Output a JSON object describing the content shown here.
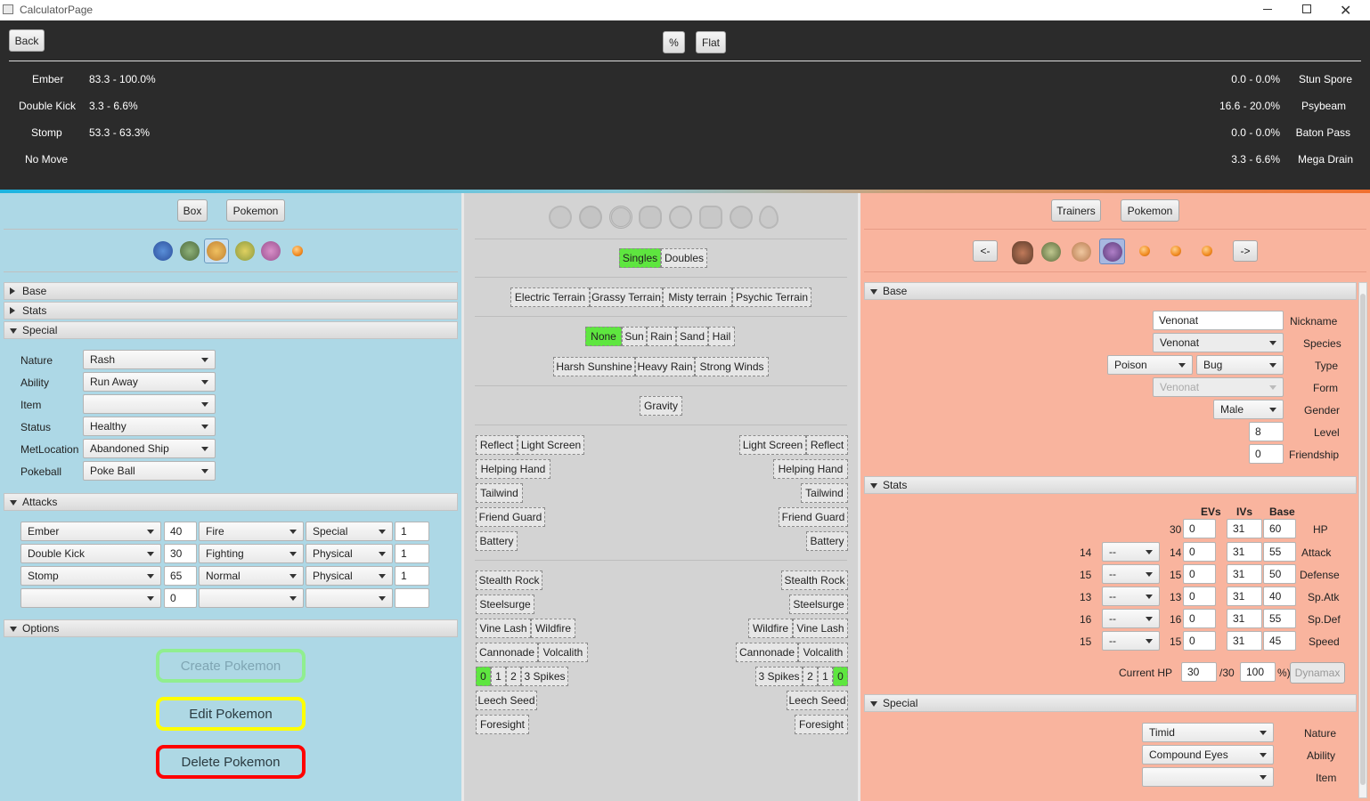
{
  "window": {
    "title": "CalculatorPage"
  },
  "top": {
    "back": "Back",
    "percent": "%",
    "flat": "Flat",
    "left_moves": [
      {
        "name": "Ember",
        "dmg": "83.3 - 100.0%"
      },
      {
        "name": "Double Kick",
        "dmg": "3.3 - 6.6%"
      },
      {
        "name": "Stomp",
        "dmg": "53.3 - 63.3%"
      },
      {
        "name": "No Move",
        "dmg": ""
      }
    ],
    "right_moves": [
      {
        "name": "Stun Spore",
        "dmg": "0.0 - 0.0%"
      },
      {
        "name": "Psybeam",
        "dmg": "16.6 - 20.0%"
      },
      {
        "name": "Baton Pass",
        "dmg": "0.0 - 0.0%"
      },
      {
        "name": "Mega Drain",
        "dmg": "3.3 - 6.6%"
      }
    ]
  },
  "left": {
    "box": "Box",
    "pokemon": "Pokemon",
    "party_icons": [
      "party-pokemon-1-icon",
      "party-pokemon-2-icon",
      "party-pokemon-3-icon",
      "party-pokemon-4-icon",
      "party-pokemon-5-icon",
      "pokeball-icon"
    ],
    "sections": {
      "base": "Base",
      "stats": "Stats",
      "special": "Special",
      "attacks": "Attacks",
      "options": "Options"
    },
    "special": {
      "nature_label": "Nature",
      "nature": "Rash",
      "ability_label": "Ability",
      "ability": "Run Away",
      "item_label": "Item",
      "item": "",
      "status_label": "Status",
      "status": "Healthy",
      "metloc_label": "MetLocation",
      "metloc": "Abandoned Ship",
      "ball_label": "Pokeball",
      "ball": "Poke Ball"
    },
    "attacks": [
      {
        "move": "Ember",
        "power": "40",
        "type": "Fire",
        "cat": "Special",
        "hits": "1"
      },
      {
        "move": "Double Kick",
        "power": "30",
        "type": "Fighting",
        "cat": "Physical",
        "hits": "1"
      },
      {
        "move": "Stomp",
        "power": "65",
        "type": "Normal",
        "cat": "Physical",
        "hits": "1"
      },
      {
        "move": "",
        "power": "0",
        "type": "",
        "cat": "",
        "hits": ""
      }
    ],
    "options": {
      "create": "Create Pokemon",
      "edit": "Edit Pokemon",
      "delete": "Delete Pokemon"
    },
    "colors": {
      "bg": "#add8e6",
      "create_border": "#90ee90",
      "edit_border": "#ffff00",
      "delete_border": "#ff0000"
    }
  },
  "middle": {
    "weather_icons": [
      "fire-type-icon",
      "water-type-icon",
      "ground-type-icon",
      "fighting-type-icon",
      "steel-type-icon",
      "flying-type-icon",
      "fairy-type-icon",
      "ice-type-icon"
    ],
    "format": [
      "Singles",
      "Doubles"
    ],
    "terrain": [
      "Electric Terrain",
      "Grassy Terrain",
      "Misty terrain",
      "Psychic Terrain"
    ],
    "weather": [
      "None",
      "Sun",
      "Rain",
      "Sand",
      "Hail"
    ],
    "weather2": [
      "Harsh Sunshine",
      "Heavy Rain",
      "Strong Winds"
    ],
    "gravity": "Gravity",
    "left_field": {
      "reflect": "Reflect",
      "light_screen": "Light Screen",
      "helping_hand": "Helping Hand",
      "tailwind": "Tailwind",
      "friend_guard": "Friend Guard",
      "battery": "Battery",
      "stealth_rock": "Stealth Rock",
      "steelsurge": "Steelsurge",
      "vine_lash": "Vine Lash",
      "wildfire": "Wildfire",
      "cannonade": "Cannonade",
      "volcalith": "Volcalith",
      "spikes": [
        "0",
        "1",
        "2",
        "3 Spikes"
      ],
      "leech_seed": "Leech Seed",
      "foresight": "Foresight"
    },
    "right_field": {
      "light_screen": "Light Screen",
      "reflect": "Reflect",
      "helping_hand": "Helping Hand",
      "tailwind": "Tailwind",
      "friend_guard": "Friend Guard",
      "battery": "Battery",
      "stealth_rock": "Stealth Rock",
      "steelsurge": "Steelsurge",
      "wildfire": "Wildfire",
      "vine_lash": "Vine Lash",
      "cannonade": "Cannonade",
      "volcalith": "Volcalith",
      "spikes": [
        "3 Spikes",
        "2",
        "1",
        "0"
      ],
      "leech_seed": "Leech Seed",
      "foresight": "Foresight"
    },
    "colors": {
      "active": "#5ee63f"
    }
  },
  "right": {
    "trainers": "Trainers",
    "pokemon": "Pokemon",
    "prev": "<-",
    "next": "->",
    "party_icons": [
      "trainer-icon",
      "party-pokemon-1-icon",
      "party-pokemon-2-icon",
      "party-pokemon-3-icon",
      "pokeball-icon",
      "pokeball-icon",
      "pokeball-icon"
    ],
    "sections": {
      "base": "Base",
      "stats": "Stats",
      "special": "Special"
    },
    "base": {
      "nickname": "Venonat",
      "nickname_label": "Nickname",
      "species": "Venonat",
      "species_label": "Species",
      "type1": "Poison",
      "type2": "Bug",
      "type_label": "Type",
      "form": "Venonat",
      "form_label": "Form",
      "gender": "Male",
      "gender_label": "Gender",
      "level": "8",
      "level_label": "Level",
      "friendship": "0",
      "friendship_label": "Friendship"
    },
    "stats": {
      "headers": [
        "EVs",
        "IVs",
        "Base"
      ],
      "hp": {
        "value": "30",
        "ev": "0",
        "iv": "31",
        "base": "60",
        "label": "HP"
      },
      "rows": [
        {
          "label": "Attack",
          "left": "14",
          "nat": "--",
          "val": "14",
          "ev": "0",
          "iv": "31",
          "base": "55"
        },
        {
          "label": "Defense",
          "left": "15",
          "nat": "--",
          "val": "15",
          "ev": "0",
          "iv": "31",
          "base": "50"
        },
        {
          "label": "Sp.Atk",
          "left": "13",
          "nat": "--",
          "val": "13",
          "ev": "0",
          "iv": "31",
          "base": "40"
        },
        {
          "label": "Sp.Def",
          "left": "16",
          "nat": "--",
          "val": "16",
          "ev": "0",
          "iv": "31",
          "base": "55"
        },
        {
          "label": "Speed",
          "left": "15",
          "nat": "--",
          "val": "15",
          "ev": "0",
          "iv": "31",
          "base": "45"
        }
      ],
      "current_hp_label": "Current HP",
      "current_hp": "30",
      "max_hp": "/30",
      "percent": "100",
      "percent_suffix": "%)",
      "dynamax": "Dynamax"
    },
    "special": {
      "nature": "Timid",
      "nature_label": "Nature",
      "ability": "Compound Eyes",
      "ability_label": "Ability",
      "item": "",
      "item_label": "Item"
    },
    "colors": {
      "bg": "#f9b49e"
    }
  }
}
